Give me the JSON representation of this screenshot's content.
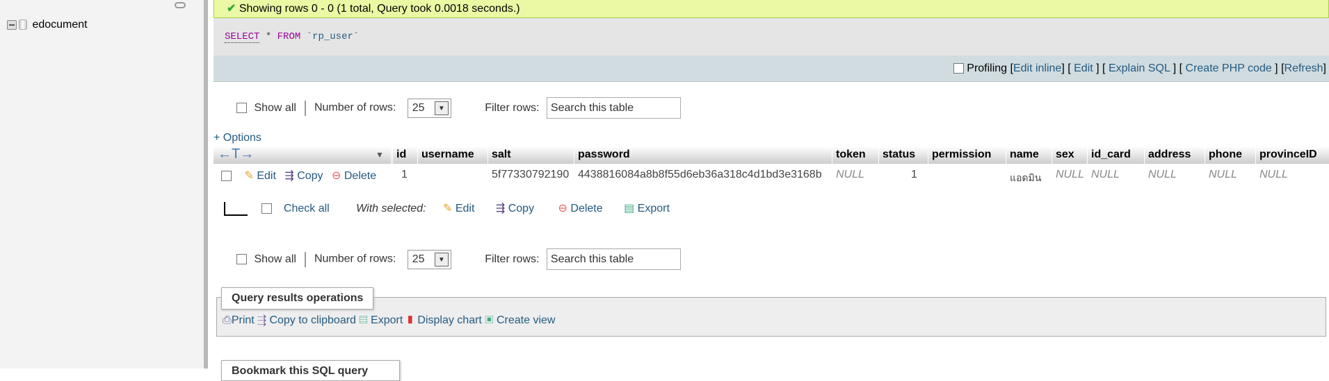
{
  "sidebar": {
    "db_name": "edocument"
  },
  "success": {
    "message": "Showing rows 0 - 0 (1 total, Query took 0.0018 seconds.)"
  },
  "sql": {
    "select": "SELECT",
    "star": "*",
    "from": "FROM",
    "table": "`rp_user`"
  },
  "profiling": {
    "label": "Profiling",
    "edit_inline": "Edit inline",
    "edit": "Edit",
    "explain": "Explain SQL",
    "php": "Create PHP code",
    "refresh": "Refresh"
  },
  "nav": {
    "show_all": "Show all",
    "num_rows_label": "Number of rows:",
    "num_rows_value": "25",
    "filter_label": "Filter rows:",
    "filter_placeholder": "Search this table"
  },
  "options_label": "+ Options",
  "table": {
    "columns": [
      "id",
      "username",
      "salt",
      "password",
      "token",
      "status",
      "permission",
      "name",
      "sex",
      "id_card",
      "address",
      "phone",
      "provinceID"
    ],
    "row": {
      "edit": "Edit",
      "copy": "Copy",
      "delete": "Delete",
      "values": [
        "1",
        "",
        "5f77330792190",
        "4438816084a8b8f55d6eb36a318c4d1bd3e3168b",
        "NULL",
        "1",
        "",
        "แอดมิน",
        "NULL",
        "NULL",
        "NULL",
        "NULL",
        "NULL"
      ]
    }
  },
  "bulk": {
    "check_all": "Check all",
    "with_selected": "With selected:",
    "edit": "Edit",
    "copy": "Copy",
    "delete": "Delete",
    "export": "Export"
  },
  "ops": {
    "title": "Query results operations",
    "print": "Print",
    "copy_clipboard": "Copy to clipboard",
    "export": "Export",
    "display_chart": "Display chart",
    "create_view": "Create view"
  },
  "bookmark": {
    "title": "Bookmark this SQL query"
  }
}
